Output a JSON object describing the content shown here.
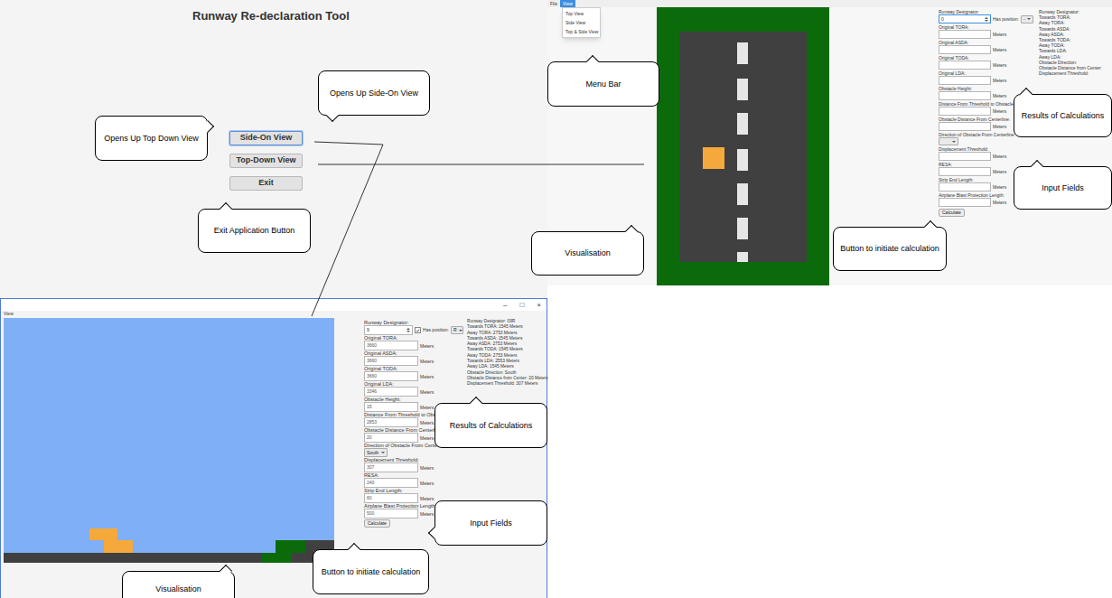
{
  "title": "Runway Re-declaration Tool",
  "launcher_buttons": [
    {
      "label": "Side-On View",
      "focused": true
    },
    {
      "label": "Top-Down View",
      "focused": false
    },
    {
      "label": "Exit",
      "focused": false
    }
  ],
  "launcher_callouts": [
    "Opens Up Top Down View",
    "Opens Up Side-On View",
    "Exit Application Button"
  ],
  "top_view": {
    "menu": [
      {
        "label": "File",
        "selected": false
      },
      {
        "label": "View",
        "selected": true
      }
    ],
    "view_menu": [
      "Top View",
      "Side View",
      "Top & Side View"
    ],
    "designator": {
      "label": "Runway Designator:",
      "value": "0",
      "focused": true,
      "has_checkbox": false,
      "checked": false,
      "has_position_label": "Has position:",
      "position": "-"
    },
    "fields": [
      {
        "label": "Original TORA:",
        "value": "",
        "unit": "Meters",
        "kind": "text"
      },
      {
        "label": "Original ASDA:",
        "value": "",
        "unit": "Meters",
        "kind": "text"
      },
      {
        "label": "Original TODA:",
        "value": "",
        "unit": "Meters",
        "kind": "text"
      },
      {
        "label": "Original LDA:",
        "value": "",
        "unit": "Meters",
        "kind": "text"
      },
      {
        "label": "Obstacle Height:",
        "value": "",
        "unit": "Meters",
        "kind": "text"
      },
      {
        "label": "Distance From Threshold to Obstacle:",
        "value": "",
        "unit": "Meters",
        "kind": "text"
      },
      {
        "label": "Obstacle Distance From Centerline:",
        "value": "",
        "unit": "Meters",
        "kind": "text"
      },
      {
        "label": "Direction of Obstacle From Centerline:",
        "value": "",
        "unit": "",
        "kind": "select"
      },
      {
        "label": "Displacement Threshold:",
        "value": "",
        "unit": "Meters",
        "kind": "text"
      },
      {
        "label": "RESA:",
        "value": "",
        "unit": "Meters",
        "kind": "text"
      },
      {
        "label": "Strip End Length:",
        "value": "",
        "unit": "Meters",
        "kind": "text"
      },
      {
        "label": "Airplane Blast Protection Length:",
        "value": "",
        "unit": "Meters",
        "kind": "text"
      }
    ],
    "calculate": "Calculate",
    "results": [
      "Runway Designator:",
      "Towards TORA:",
      "Away TORA:",
      "Towards ASDA:",
      "Away ASDA:",
      "Towards TODA:",
      "Away TODA:",
      "Towards LDA:",
      "Away LDA:",
      "Obstacle Direction:",
      "Obstacle Distance from Center:",
      "Displacement Threshold:"
    ],
    "callouts": [
      "Menu Bar",
      "Visualisation",
      "Button to initiate calculation",
      "Results of Calculations",
      "Input Fields"
    ]
  },
  "side_view": {
    "window_controls": [
      "–",
      "□",
      "×"
    ],
    "menu": [
      {
        "label": "View",
        "selected": false
      }
    ],
    "designator": {
      "label": "Runway Designator:",
      "value": "9",
      "focused": false,
      "has_checkbox": true,
      "checked": true,
      "has_position_label": "Has position:",
      "position": "R"
    },
    "fields": [
      {
        "label": "Original TORA:",
        "value": "3660",
        "unit": "Meters",
        "kind": "text"
      },
      {
        "label": "Original ASDA:",
        "value": "3660",
        "unit": "Meters",
        "kind": "text"
      },
      {
        "label": "Original TODA:",
        "value": "3660",
        "unit": "Meters",
        "kind": "text"
      },
      {
        "label": "Original LDA:",
        "value": "3346",
        "unit": "Meters",
        "kind": "text"
      },
      {
        "label": "Obstacle Height:",
        "value": "15",
        "unit": "Meters",
        "kind": "text"
      },
      {
        "label": "Distance From Threshold to Obstacle:",
        "value": "2853",
        "unit": "Meters",
        "kind": "text"
      },
      {
        "label": "Obstacle Distance From Centerline:",
        "value": "20",
        "unit": "Meters",
        "kind": "text"
      },
      {
        "label": "Direction of Obstacle From Centerline:",
        "value": "South",
        "unit": "",
        "kind": "select"
      },
      {
        "label": "Displacement Threshold:",
        "value": "307",
        "unit": "Meters",
        "kind": "text"
      },
      {
        "label": "RESA:",
        "value": "240",
        "unit": "Meters",
        "kind": "text"
      },
      {
        "label": "Strip End Length:",
        "value": "60",
        "unit": "Meters",
        "kind": "text"
      },
      {
        "label": "Airplane Blast Protection Length:",
        "value": "500",
        "unit": "Meters",
        "kind": "text"
      }
    ],
    "calculate": "Calculate",
    "results": [
      "Runway Designator: 09R",
      "Towards TORA: 1545 Meters",
      "Away TORA: 2753 Meters",
      "Towards ASDA: 1545 Meters",
      "Away ASDA: 2753 Meters",
      "Towards TODA: 1545 Meters",
      "Away TODA: 2753 Meters",
      "Towards LDA: 2553 Meters",
      "Away LDA: 1545 Meters",
      "Obstacle Direction: South",
      "Obstacle Distance from Center: 20 Meters",
      "Displacement Threshold: 307 Meters"
    ],
    "callouts": [
      "Results of Calculations",
      "Input Fields",
      "Button to initiate calculation",
      "Visualisation"
    ]
  }
}
